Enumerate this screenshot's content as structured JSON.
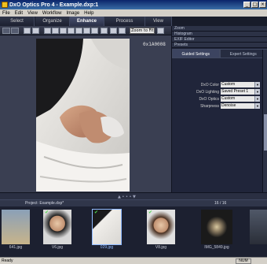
{
  "window": {
    "title": "DxO Optics Pro 4 - Example.dxp:1",
    "buttons": [
      "_",
      "□",
      "×"
    ]
  },
  "menu": [
    "File",
    "Edit",
    "View",
    "Workflow",
    "Image",
    "Help"
  ],
  "tabs": [
    {
      "label": "Select",
      "active": false
    },
    {
      "label": "Organize",
      "active": false
    },
    {
      "label": "Enhance",
      "active": true
    },
    {
      "label": "Process",
      "active": false
    },
    {
      "label": "View",
      "active": false
    }
  ],
  "toolbar": {
    "zoom_value": "Zoom to Fit"
  },
  "viewer": {
    "coord_readout": "0x1A0008"
  },
  "panel": {
    "palettes": [
      "Zoom",
      "Histogram",
      "EXIF Editor",
      "Presets"
    ],
    "tabs": [
      {
        "label": "Guided Settings",
        "active": true
      },
      {
        "label": "Expert Settings",
        "active": false
      }
    ],
    "settings": [
      {
        "label": "DxO Color",
        "value": "Custom"
      },
      {
        "label": "DxO Lighting",
        "value": "Saved Preset 1"
      },
      {
        "label": "DxO Optics",
        "value": "Custom"
      },
      {
        "label": "Sharpness",
        "value": "Denoise"
      }
    ]
  },
  "project": {
    "label": "Project:  Example.dxp*",
    "count": "16 / 16"
  },
  "filmstrip": [
    {
      "name": "641.jpg",
      "checked": false,
      "selected": false
    },
    {
      "name": "V6.jpg",
      "checked": true,
      "selected": false
    },
    {
      "name": "029.jpg",
      "checked": true,
      "selected": true
    },
    {
      "name": "V8.jpg",
      "checked": true,
      "selected": false
    },
    {
      "name": "IMG_5849.jpg",
      "checked": false,
      "selected": false
    },
    {
      "name": "",
      "checked": false,
      "selected": false
    }
  ],
  "status": {
    "text": "Ready",
    "indicator": "NUM"
  },
  "colors": {
    "accent": "#0a246a",
    "panel_bg": "#20253a",
    "viewer_bg": "#3a3f52"
  }
}
